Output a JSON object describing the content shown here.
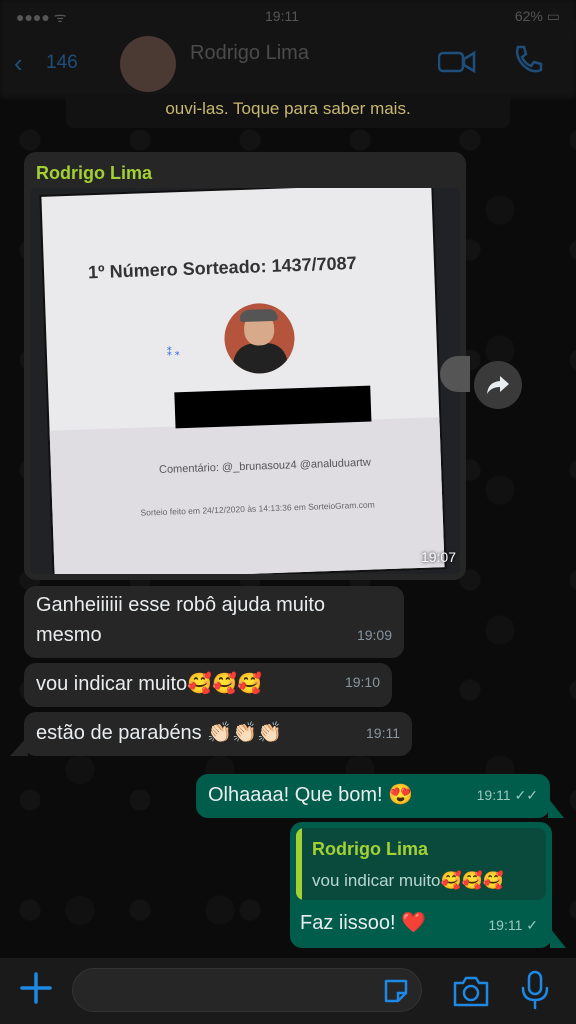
{
  "header": {
    "status_time": "19:11",
    "status_signal": "●●●● ᯤ",
    "status_battery": "62% ▭",
    "back_count": "146",
    "contact_name": "Rodrigo Lima"
  },
  "banner": {
    "text": "ouvi-las. Toque para saber mais."
  },
  "messages": {
    "image_msg": {
      "sender": "Rodrigo Lima",
      "photo_title": "1º Número Sorteado: 1437/7087",
      "photo_comment": "Comentário: @_brunasouz4 @analuduartw",
      "photo_footer": "Sorteio feito em 24/12/2020 às 14:13:36 em SorteioGram.com",
      "time": "19:07"
    },
    "m1": {
      "text": "Ganheiiiiii esse robô ajuda muito mesmo",
      "time": "19:09"
    },
    "m2": {
      "text": "vou indicar muito🥰🥰🥰",
      "time": "19:10"
    },
    "m3": {
      "text": "estão de parabéns 👏🏻👏🏻👏🏻",
      "time": "19:11"
    },
    "m4": {
      "text": "Olhaaaa! Que bom! 😍",
      "time": "19:11 ✓✓"
    },
    "m5": {
      "quote_name": "Rodrigo Lima",
      "quote_text": "vou indicar muito🥰🥰🥰",
      "text": "Faz iissoo! ❤️",
      "time": "19:11 ✓"
    }
  },
  "colors": {
    "accent_blue": "#1e88e5",
    "incoming": "#262626",
    "outgoing": "#005c4b",
    "sender_name": "#a3d134"
  },
  "icons": [
    "back-chevron-icon",
    "video-call-icon",
    "phone-icon",
    "forward-icon",
    "plus-icon",
    "sticker-icon",
    "camera-icon",
    "mic-icon"
  ]
}
